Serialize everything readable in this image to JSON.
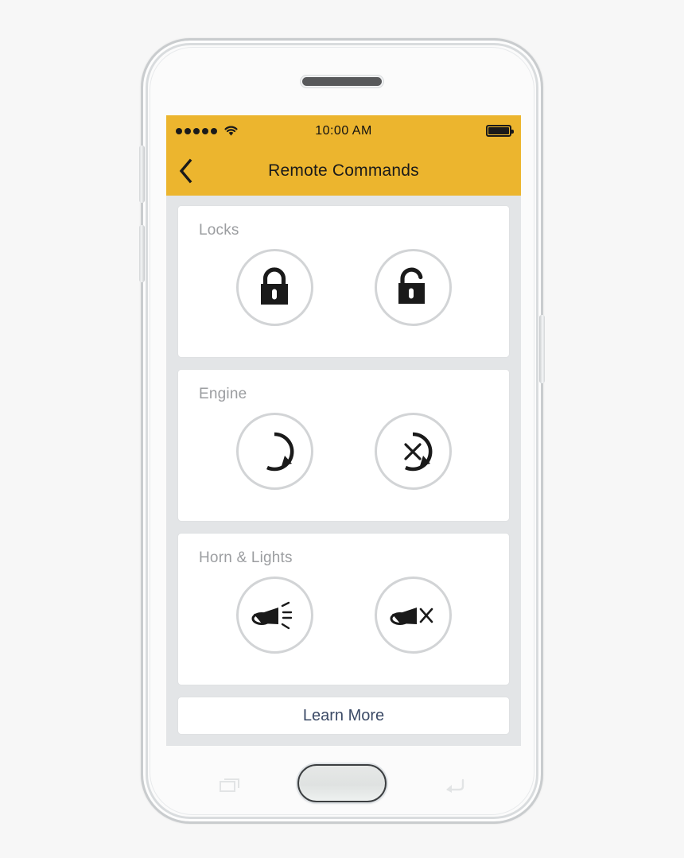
{
  "device": {
    "type": "smartphone-mockup",
    "earpiece": "speaker-grille",
    "buttons": {
      "volume_up": "volume-up-button",
      "volume_down": "volume-down-button",
      "power": "power-button",
      "home": "home-button",
      "recent_apps": "recent-apps-button",
      "back": "back-button"
    }
  },
  "colors": {
    "accent_yellow": "#ECB52E",
    "screen_background": "#E3E5E7",
    "card_background": "#FFFFFF",
    "card_border": "#DFE1E3",
    "title_gray": "#9B9DA0",
    "icon_black": "#1A1A1A",
    "circle_border": "#D2D4D6",
    "link_navy": "#3B4A66"
  },
  "status_bar": {
    "signal_dots": 5,
    "signal_icon": "signal-dots-icon",
    "wifi_icon": "wifi-icon",
    "time": "10:00  AM",
    "battery_icon": "battery-full-icon",
    "battery_level": "100"
  },
  "nav_bar": {
    "back_icon": "chevron-left-icon",
    "title": "Remote Commands"
  },
  "cards": [
    {
      "title": "Locks",
      "name": "locks-card",
      "buttons": [
        {
          "name": "lock-button",
          "icon": "lock-closed-icon",
          "label": "Lock"
        },
        {
          "name": "unlock-button",
          "icon": "lock-open-icon",
          "label": "Unlock"
        }
      ]
    },
    {
      "title": "Engine",
      "name": "engine-card",
      "buttons": [
        {
          "name": "engine-start-button",
          "icon": "circular-arrow-icon",
          "label": "Start Engine"
        },
        {
          "name": "engine-stop-button",
          "icon": "circular-arrow-x-icon",
          "label": "Stop Engine"
        }
      ]
    },
    {
      "title": "Horn & Lights",
      "name": "horn-lights-card",
      "buttons": [
        {
          "name": "horn-on-button",
          "icon": "horn-sound-icon",
          "label": "Horn On"
        },
        {
          "name": "horn-off-button",
          "icon": "horn-mute-icon",
          "label": "Horn Off"
        }
      ]
    }
  ],
  "footer": {
    "learn_more_label": "Learn More"
  }
}
